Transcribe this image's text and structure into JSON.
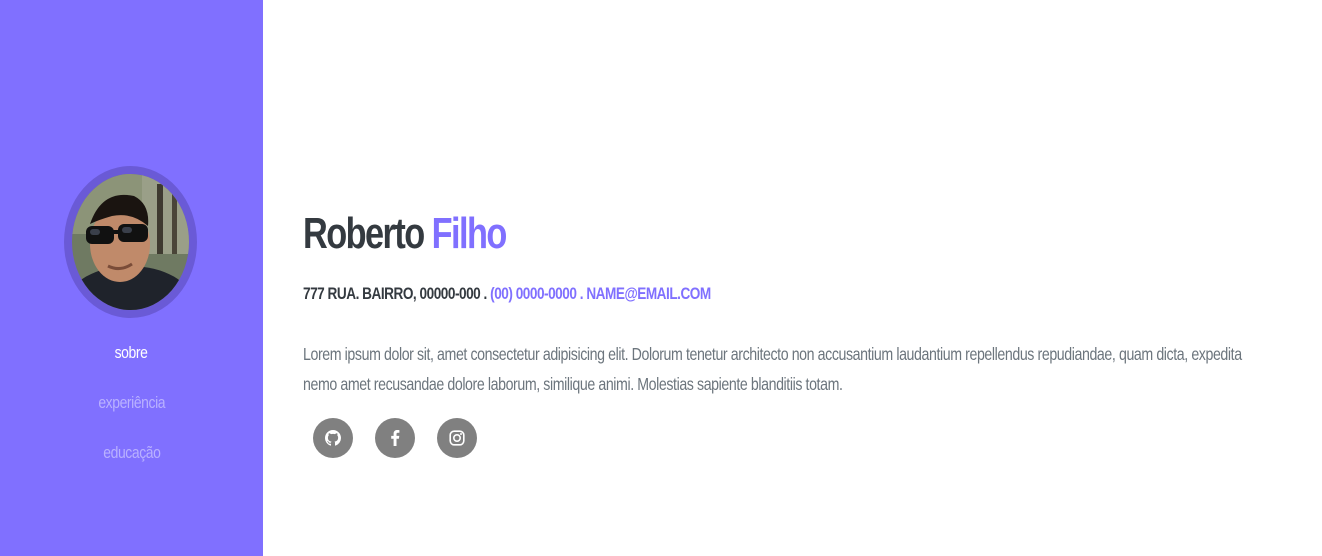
{
  "sidebar": {
    "avatar_alt": "profile photo",
    "nav": [
      {
        "label": "sobre",
        "active": true
      },
      {
        "label": "experiência",
        "active": false
      },
      {
        "label": "educação",
        "active": false
      }
    ]
  },
  "header": {
    "first_name": "Roberto",
    "last_name": "Filho"
  },
  "contact": {
    "address": "777 Rua. Bairro, 00000-000 .",
    "phone": "(00) 0000-0000",
    "separator": ".",
    "email": "name@email.com"
  },
  "about": {
    "text": "Lorem ipsum dolor sit, amet consectetur adipisicing elit. Dolorum tenetur architecto non accusantium laudantium repellendus repudiandae, quam dicta, expedita nemo amet recusandae dolore laborum, similique animi. Molestias sapiente blanditiis totam."
  },
  "social": [
    {
      "icon": "github-icon"
    },
    {
      "icon": "facebook-icon"
    },
    {
      "icon": "instagram-icon"
    }
  ],
  "colors": {
    "sidebar": "#8070ff",
    "accent": "#8070ff",
    "nav_inactive": "#b9b1ff",
    "text_dark": "#343a40",
    "text_muted": "#6c757d",
    "social_bg": "#808080"
  }
}
